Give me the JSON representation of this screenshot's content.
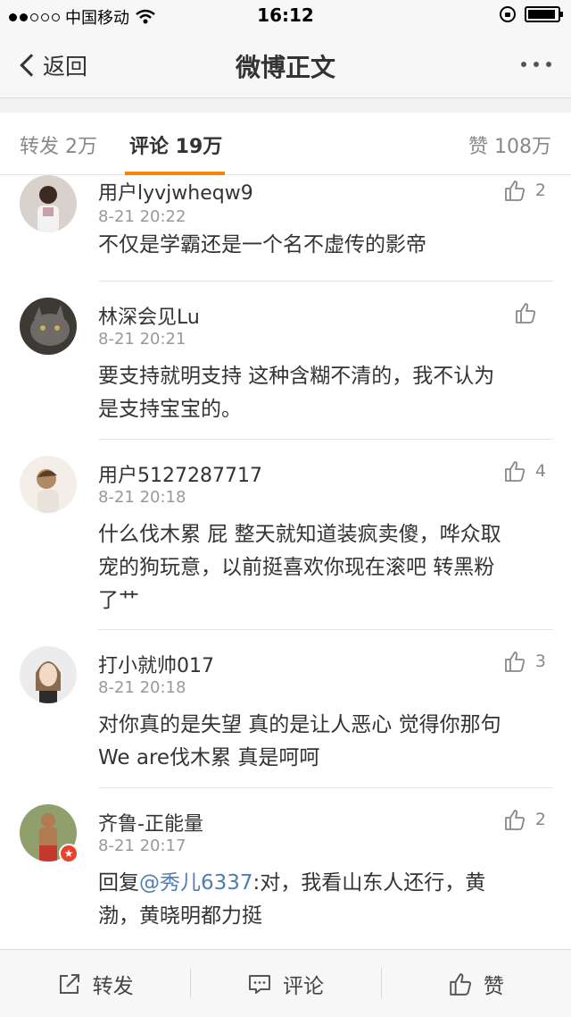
{
  "status_bar": {
    "carrier": "中国移动",
    "time": "16:12"
  },
  "nav": {
    "back_label": "返回",
    "title": "微博正文"
  },
  "tabs": {
    "repost": "转发 2万",
    "comment": "评论 19万",
    "like": "赞 108万"
  },
  "comments": [
    {
      "user": "用户lyvjwheqw9",
      "time": "8-21 20:22",
      "text": "不仅是学霸还是一个名不虚传的影帝",
      "likes": "2"
    },
    {
      "user": "林深会见Lu",
      "time": "8-21 20:21",
      "text_l1": "要支持就明支持 这种含糊不清的，我不认为",
      "text_l2": "是支持宝宝的。",
      "likes": ""
    },
    {
      "user": "用户5127287717",
      "time": "8-21 20:18",
      "text_l1": "什么伐木累 屁 整天就知道装疯卖傻，哗众取",
      "text_l2": "宠的狗玩意，以前挺喜欢你现在滚吧 转黑粉",
      "text_l3": "了艹",
      "likes": "4"
    },
    {
      "user": "打小就帅017",
      "time": "8-21 20:18",
      "text_l1": "对你真的是失望  真的是让人恶心 觉得你那句",
      "text_l2": "We are伐木累 真是呵呵",
      "likes": "3"
    },
    {
      "user": "齐鲁-正能量",
      "time": "8-21 20:17",
      "reply_prefix": "回复",
      "mention": "@秀儿6337",
      "text_l1_rest": ":对，我看山东人还行，黄",
      "text_l2": "渤，黄晓明都力挺",
      "likes": "2"
    }
  ],
  "toolbar": {
    "repost": "转发",
    "comment": "评论",
    "like": "赞"
  },
  "colors": {
    "accent": "#ff8200",
    "mention": "#507daf",
    "muted": "#999999"
  }
}
